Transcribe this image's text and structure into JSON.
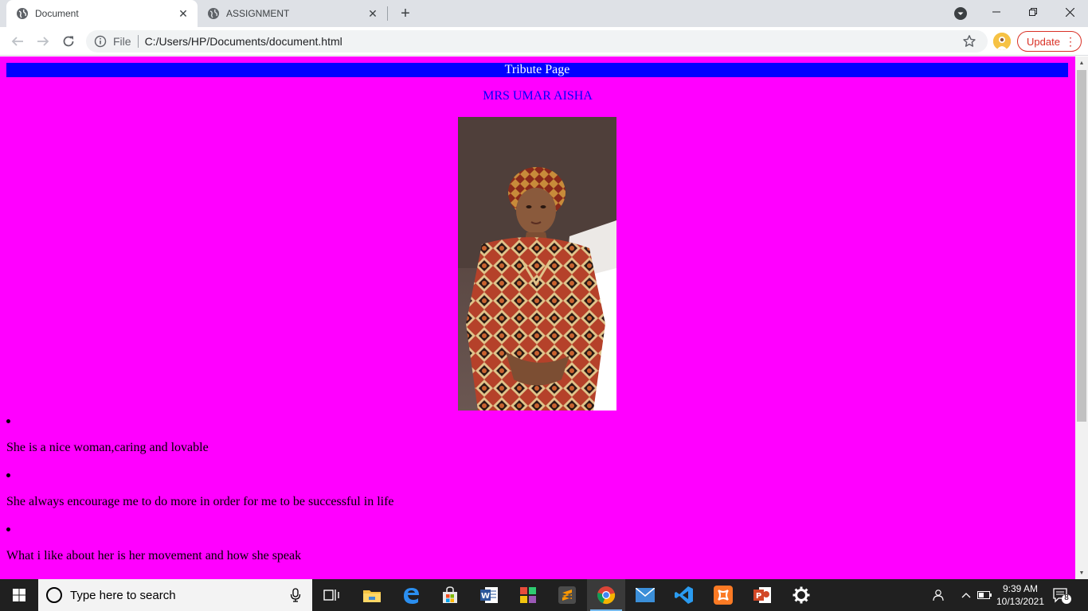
{
  "browser": {
    "tabs": [
      {
        "title": "Document",
        "active": true,
        "icon": "globe-icon"
      },
      {
        "title": "ASSIGNMENT",
        "active": false,
        "icon": "globe-icon"
      }
    ],
    "address": {
      "scheme_label": "File",
      "url": "C:/Users/HP/Documents/document.html"
    },
    "update_label": "Update"
  },
  "page": {
    "banner_title": "Tribute Page",
    "subject_name": "MRS UMAR AISHA",
    "items": [
      "She is a nice woman,caring and lovable",
      "She always encourage me to do more in order for me to be successful in life",
      "What i like about her is her movement and how she speak"
    ],
    "colors": {
      "background": "#ff00ff",
      "banner": "#0000ff",
      "name": "#0000ff"
    }
  },
  "taskbar": {
    "search_placeholder": "Type here to search",
    "apps": [
      "task-view",
      "file-explorer",
      "edge",
      "store",
      "word",
      "app-grid",
      "sublime-text",
      "chrome",
      "mail",
      "vscode",
      "xampp",
      "powerpoint",
      "settings"
    ],
    "time": "9:39 AM",
    "date": "10/13/2021",
    "notification_count": "8"
  }
}
